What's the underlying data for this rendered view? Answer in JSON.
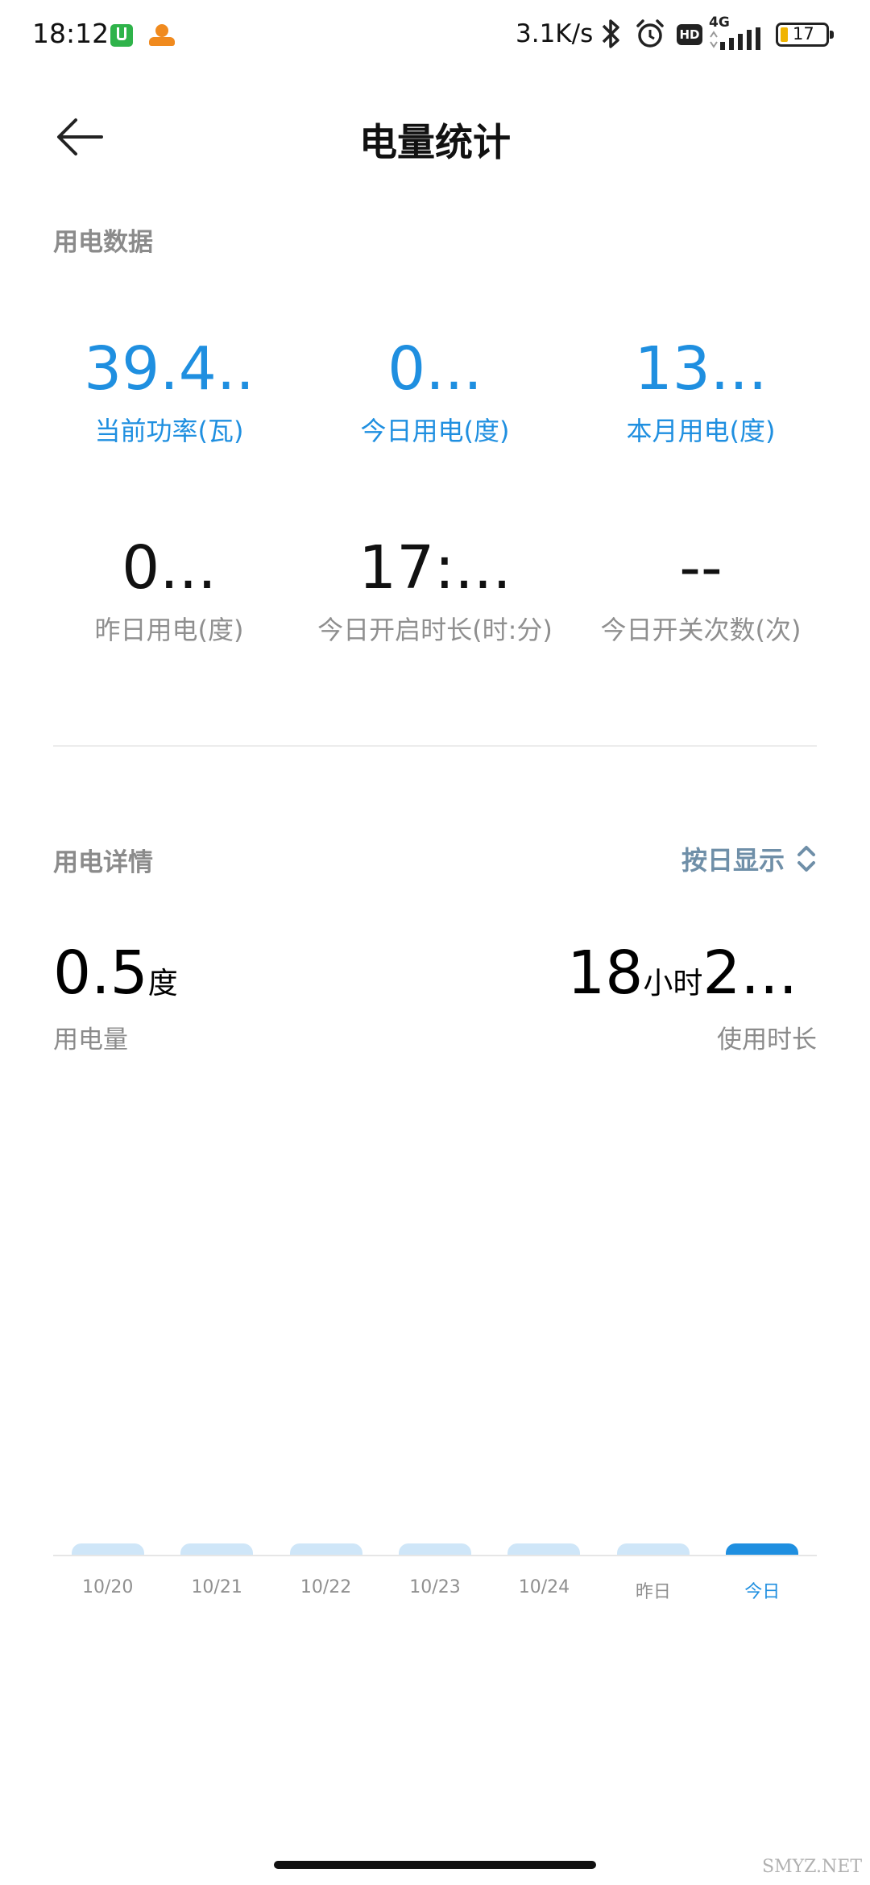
{
  "status_bar": {
    "time": "18:12",
    "network_speed": "3.1K/s",
    "network_type": "4G",
    "hd_label": "HD",
    "battery": "17"
  },
  "header": {
    "title": "电量统计"
  },
  "electricity_data": {
    "section_title": "用电数据",
    "stats": [
      {
        "value": "39.4..",
        "label": "当前功率(瓦)"
      },
      {
        "value": "0...",
        "label": "今日用电(度)"
      },
      {
        "value": "13...",
        "label": "本月用电(度)"
      },
      {
        "value": "0...",
        "label": "昨日用电(度)"
      },
      {
        "value": "17:...",
        "label": "今日开启时长(时:分)"
      },
      {
        "value": "--",
        "label": "今日开关次数(次)"
      }
    ]
  },
  "electricity_details": {
    "section_title": "用电详情",
    "mode_select": "按日显示",
    "usage": {
      "value": "0.5",
      "unit": "度",
      "label": "用电量"
    },
    "duration": {
      "hours": "18",
      "hours_unit": "小时",
      "minutes": "2...",
      "label": "使用时长"
    }
  },
  "chart_data": {
    "type": "bar",
    "categories": [
      "10/20",
      "10/21",
      "10/22",
      "10/23",
      "10/24",
      "昨日",
      "今日"
    ],
    "series": [
      {
        "values": [
          0.0,
          0.0,
          0.0,
          0.0,
          0.0,
          0.0,
          0.0
        ]
      }
    ],
    "selected_category": "今日",
    "colors": {
      "bar": "#cfe6f8",
      "selected": "#1f8fe0"
    }
  },
  "watermark": "SMYZ.NET"
}
